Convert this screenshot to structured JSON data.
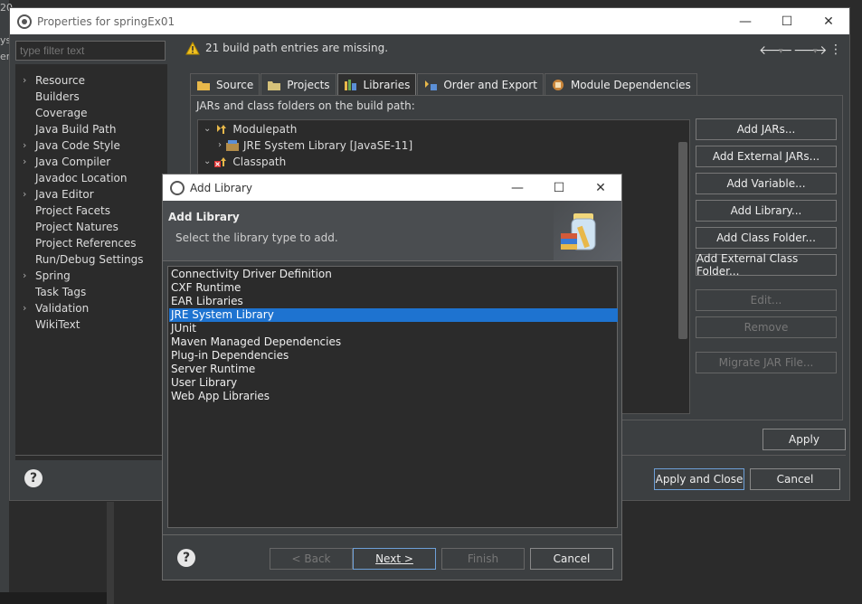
{
  "background": {
    "fragments": [
      "20",
      "ys",
      "er"
    ]
  },
  "window": {
    "title": "Properties for springEx01",
    "minimize": "—",
    "maximize": "☐",
    "close": "✕"
  },
  "filter": {
    "placeholder": "type filter text"
  },
  "nav": {
    "items": [
      {
        "label": "Resource",
        "expandable": true
      },
      {
        "label": "Builders",
        "expandable": false
      },
      {
        "label": "Coverage",
        "expandable": false
      },
      {
        "label": "Java Build Path",
        "expandable": false
      },
      {
        "label": "Java Code Style",
        "expandable": true
      },
      {
        "label": "Java Compiler",
        "expandable": true
      },
      {
        "label": "Javadoc Location",
        "expandable": false
      },
      {
        "label": "Java Editor",
        "expandable": true
      },
      {
        "label": "Project Facets",
        "expandable": false
      },
      {
        "label": "Project Natures",
        "expandable": false
      },
      {
        "label": "Project References",
        "expandable": false
      },
      {
        "label": "Run/Debug Settings",
        "expandable": false
      },
      {
        "label": "Spring",
        "expandable": true
      },
      {
        "label": "Task Tags",
        "expandable": false
      },
      {
        "label": "Validation",
        "expandable": true
      },
      {
        "label": "WikiText",
        "expandable": false
      }
    ]
  },
  "message": {
    "text": "21 build path entries are missing."
  },
  "toolbar": {
    "back": "🡐",
    "forward": "🡒",
    "menu": "⋮"
  },
  "tabs": [
    {
      "label": "Source"
    },
    {
      "label": "Projects"
    },
    {
      "label": "Libraries"
    },
    {
      "label": "Order and Export"
    },
    {
      "label": "Module Dependencies"
    }
  ],
  "libraries": {
    "heading": "JARs and class folders on the build path:",
    "tree": {
      "modulepath": "Modulepath",
      "jre": "JRE System Library [JavaSE-11]",
      "classpath": "Classpath"
    },
    "buttons": {
      "add_jars": "Add JARs...",
      "add_external_jars": "Add External JARs...",
      "add_variable": "Add Variable...",
      "add_library": "Add Library...",
      "add_class_folder": "Add Class Folder...",
      "add_external_class_folder": "Add External Class Folder...",
      "edit": "Edit...",
      "remove": "Remove",
      "migrate": "Migrate JAR File..."
    }
  },
  "footer": {
    "apply": "Apply",
    "apply_close": "Apply and Close",
    "cancel": "Cancel",
    "help": "?"
  },
  "dialog": {
    "title": "Add Library",
    "heading": "Add Library",
    "subheading": "Select the library type to add.",
    "minimize": "—",
    "maximize": "☐",
    "close": "✕",
    "items": [
      "Connectivity Driver Definition",
      "CXF Runtime",
      "EAR Libraries",
      "JRE System Library",
      "JUnit",
      "Maven Managed Dependencies",
      "Plug-in Dependencies",
      "Server Runtime",
      "User Library",
      "Web App Libraries"
    ],
    "selected_index": 3,
    "buttons": {
      "back": "< Back",
      "next": "Next >",
      "finish": "Finish",
      "cancel": "Cancel",
      "help": "?"
    }
  },
  "colors": {
    "selection": "#1e73d0",
    "panel": "#3c3f41",
    "field": "#2b2b2b",
    "warning": "#f0c020"
  }
}
